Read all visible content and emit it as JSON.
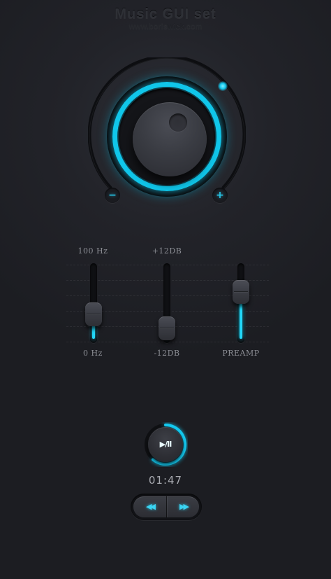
{
  "header": {
    "title": "Music GUI set",
    "url_prefix": "www.boris",
    "url_bold": "wick",
    "url_suffix": ".com"
  },
  "volume_knob": {
    "minus_label": "−",
    "plus_label": "+",
    "accent_color": "#10c6ea"
  },
  "sliders": [
    {
      "name": "frequency",
      "top_label": "100 Hz",
      "bottom_label": "0 Hz",
      "level": 0.3
    },
    {
      "name": "gain",
      "top_label": "+12DB",
      "bottom_label": "-12DB",
      "level": 0.05
    },
    {
      "name": "preamp",
      "top_label": "",
      "bottom_label": "PREAMP",
      "level": 0.7
    }
  ],
  "player": {
    "play_pause_icon": "play-pause-icon",
    "play_label": "▶",
    "separator": "/",
    "pause_label": "II",
    "elapsed_time": "01:47",
    "prev_icon": "previous-track-icon",
    "prev_label": "◀◀",
    "next_icon": "next-track-icon",
    "next_label": "▶▶"
  },
  "colors": {
    "accent": "#22d6f6",
    "background": "#1e1f24"
  }
}
